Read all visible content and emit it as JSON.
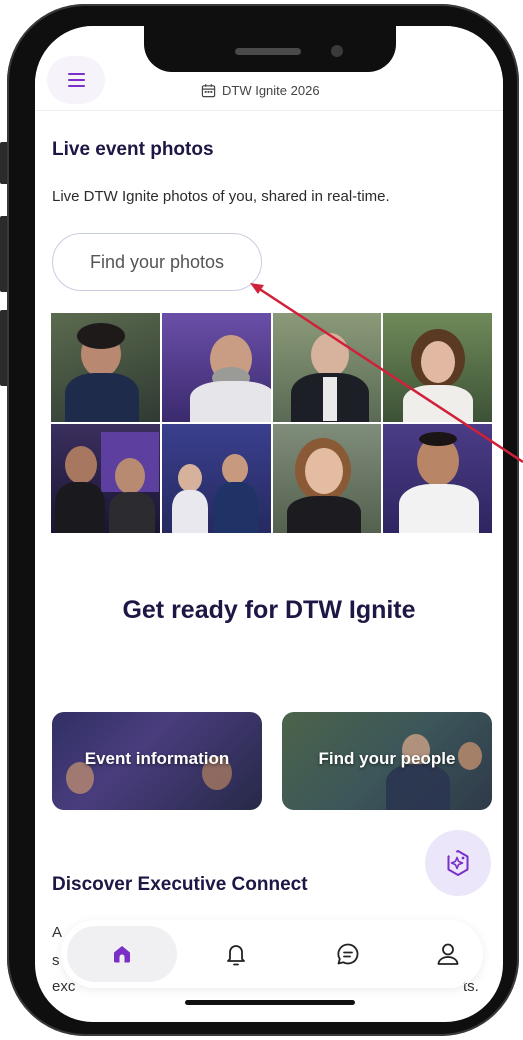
{
  "header": {
    "event_title": "DTW Ignite 2026",
    "menu_icon": "menu-icon",
    "calendar_icon": "calendar-icon"
  },
  "live_photos": {
    "title": "Live event photos",
    "subtitle": "Live DTW Ignite photos of you, shared in real-time.",
    "find_button": "Find your photos"
  },
  "photo_grid": {
    "photos": [
      {
        "name": "photo-1"
      },
      {
        "name": "photo-2"
      },
      {
        "name": "photo-3"
      },
      {
        "name": "photo-4"
      },
      {
        "name": "photo-5"
      },
      {
        "name": "photo-6"
      },
      {
        "name": "photo-7"
      },
      {
        "name": "photo-8"
      }
    ]
  },
  "get_ready": {
    "title": "Get ready for DTW Ignite",
    "cards": [
      {
        "label": "Event information"
      },
      {
        "label": "Find your people"
      }
    ]
  },
  "discover": {
    "title": "Discover Executive Connect",
    "lines": [
      "A",
      "s",
      "exc",
      "ts."
    ]
  },
  "bottom_nav": {
    "items": [
      {
        "name": "home",
        "icon": "home-icon",
        "active": true
      },
      {
        "name": "notifications",
        "icon": "bell-icon",
        "active": false
      },
      {
        "name": "messages",
        "icon": "chat-icon",
        "active": false
      },
      {
        "name": "profile",
        "icon": "user-icon",
        "active": false
      }
    ]
  },
  "colors": {
    "accent": "#7a2fc7",
    "heading": "#1c1744",
    "fab_bg": "#ece6fb"
  }
}
